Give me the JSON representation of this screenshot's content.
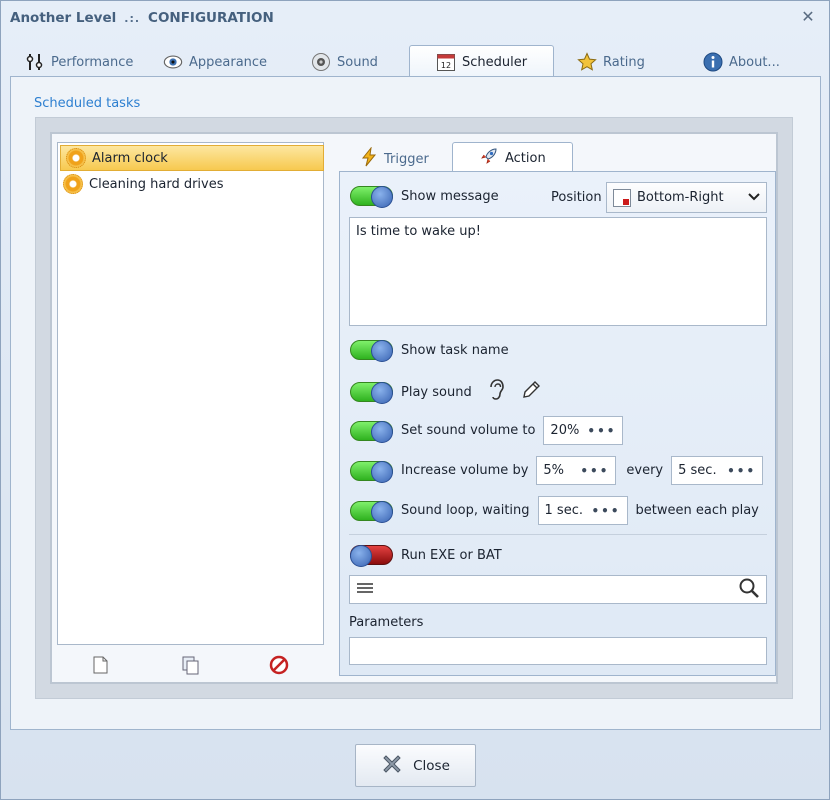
{
  "window": {
    "app_name": "Another Level",
    "separator": ".:.",
    "title": "CONFIGURATION"
  },
  "tabs": [
    {
      "label": "Performance",
      "icon": "sliders-icon"
    },
    {
      "label": "Appearance",
      "icon": "eye-icon"
    },
    {
      "label": "Sound",
      "icon": "speaker-icon"
    },
    {
      "label": "Scheduler",
      "icon": "calendar-icon",
      "badge": "12",
      "active": true
    },
    {
      "label": "Rating",
      "icon": "star-icon"
    },
    {
      "label": "About...",
      "icon": "info-icon"
    }
  ],
  "scheduled": {
    "group_label": "Scheduled tasks",
    "tasks": [
      {
        "label": "Alarm clock",
        "selected": true
      },
      {
        "label": "Cleaning hard drives",
        "selected": false
      }
    ]
  },
  "subtabs": [
    {
      "label": "Trigger",
      "icon": "lightning-icon"
    },
    {
      "label": "Action",
      "icon": "rocket-icon",
      "active": true
    }
  ],
  "action": {
    "show_message": {
      "label": "Show message",
      "on": true
    },
    "position_label": "Position",
    "position_value": "Bottom-Right",
    "message_text": "Is time to wake up!",
    "show_task_name": {
      "label": "Show task name",
      "on": true
    },
    "play_sound": {
      "label": "Play sound",
      "on": true
    },
    "set_volume": {
      "label": "Set sound volume to",
      "value": "20%",
      "on": true
    },
    "increase_volume": {
      "label": "Increase volume by",
      "value": "5%",
      "every_label": "every",
      "every_value": "5 sec.",
      "on": true
    },
    "sound_loop": {
      "label": "Sound loop, waiting",
      "value": "1 sec.",
      "suffix": "between each play",
      "on": true
    },
    "run_exe": {
      "label": "Run EXE or BAT",
      "on": false
    },
    "path_value": "",
    "parameters_label": "Parameters",
    "parameters_value": ""
  },
  "footer": {
    "close_label": "Close"
  }
}
